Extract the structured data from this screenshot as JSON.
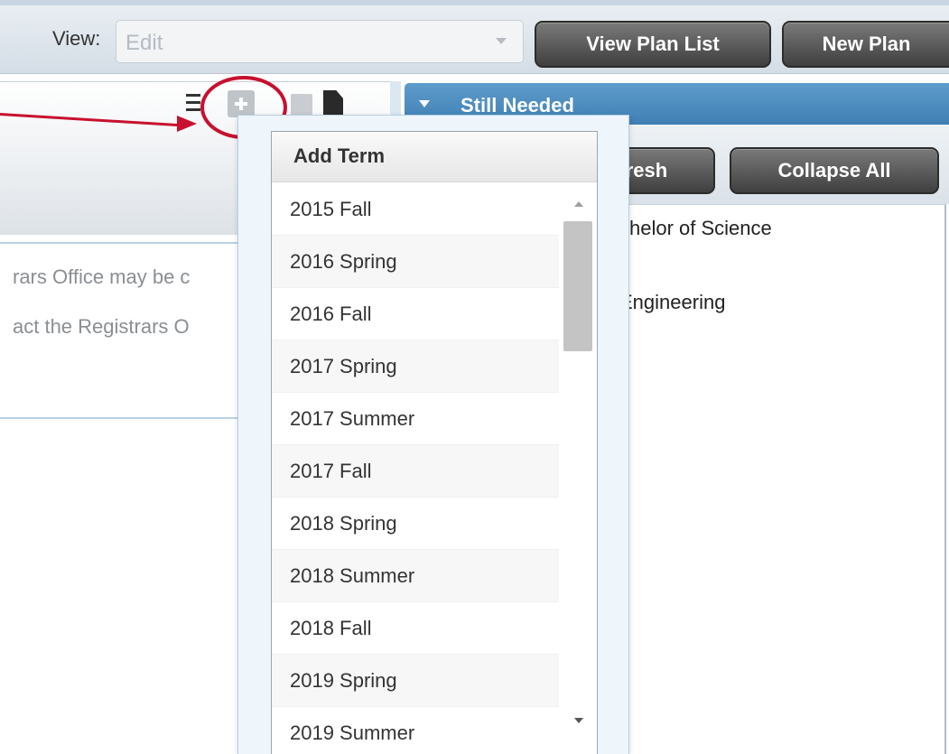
{
  "toolbar": {
    "view_label": "View:",
    "view_select_value": "Edit",
    "view_plan_list_label": "View Plan List",
    "new_plan_label": "New Plan"
  },
  "left_panel": {
    "lines": [
      "rars Office may be c",
      "act the Registrars O"
    ]
  },
  "right_panel": {
    "still_needed_title": "Still Needed",
    "refresh_label": "resh",
    "collapse_all_label": "Collapse All",
    "content_lines": [
      "chelor of Science",
      "Engineering"
    ]
  },
  "add_term_dropdown": {
    "header": "Add Term",
    "terms": [
      "2015 Fall",
      "2016 Spring",
      "2016 Fall",
      "2017 Spring",
      "2017 Summer",
      "2017 Fall",
      "2018 Spring",
      "2018 Summer",
      "2018 Fall",
      "2019 Spring",
      "2019 Summer"
    ]
  },
  "colors": {
    "annotation": "#c8102e",
    "panel_header_blue": "#4a8bbf",
    "button_dark": "#4a4a4a"
  },
  "icons": [
    "tree-icon",
    "add-term-icon",
    "remove-term-icon",
    "document-icon",
    "dropdown-arrow-icon",
    "collapse-caret-icon",
    "scroll-up-icon",
    "scroll-down-icon"
  ]
}
